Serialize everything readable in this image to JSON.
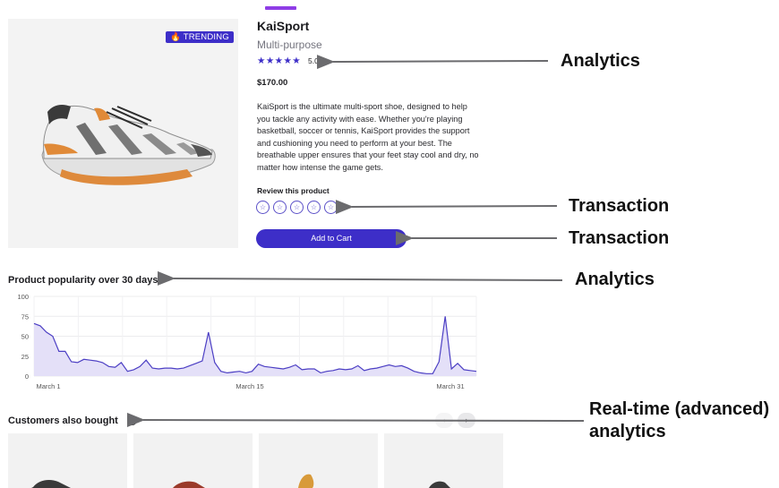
{
  "product": {
    "badge": "🔥 TRENDING",
    "name": "KaiSport",
    "category": "Multi-purpose",
    "rating_stars": "★★★★★",
    "rating": "5.0",
    "price": "$170.00",
    "description": "KaiSport is the ultimate multi-sport shoe, designed to help you tackle any activity with ease. Whether you're playing basketball, soccer or tennis, KaiSport provides the support and cushioning you need to perform at your best. The breathable upper ensures that your feet stay cool and dry, no matter how intense the game gets."
  },
  "review": {
    "label": "Review this product",
    "star_glyph": "☆"
  },
  "cart": {
    "label": "Add to Cart"
  },
  "chart_data": {
    "type": "area",
    "title": "Product popularity over 30 days",
    "xlabel": "",
    "ylabel": "",
    "x_ticks": [
      "March 1",
      "March 15",
      "March 31"
    ],
    "y_ticks": [
      "100",
      "75",
      "50",
      "25",
      "0"
    ],
    "ylim": [
      0,
      100
    ],
    "grid": true,
    "color": "#4c3fc4",
    "fill": "#e4e0f8",
    "values": [
      66,
      63,
      55,
      50,
      31,
      31,
      18,
      17,
      21,
      20,
      19,
      17,
      12,
      11,
      17,
      6,
      8,
      12,
      20,
      10,
      9,
      10,
      10,
      9,
      10,
      13,
      16,
      19,
      55,
      17,
      6,
      4,
      5,
      6,
      4,
      6,
      15,
      12,
      11,
      10,
      9,
      11,
      14,
      8,
      9,
      9,
      4,
      6,
      7,
      9,
      8,
      9,
      13,
      7,
      9,
      10,
      12,
      14,
      12,
      13,
      10,
      6,
      4,
      3,
      3,
      18,
      75,
      9,
      16,
      8,
      7,
      6
    ]
  },
  "also_bought": {
    "title": "Customers also bought",
    "help_icon": "question-icon",
    "prev": "‹",
    "next": "›"
  },
  "annotations": {
    "analytics_1": "Analytics",
    "transaction_1": "Transaction",
    "transaction_2": "Transaction",
    "analytics_2": "Analytics",
    "realtime_line1": "Real-time (advanced)",
    "realtime_line2": "analytics"
  }
}
